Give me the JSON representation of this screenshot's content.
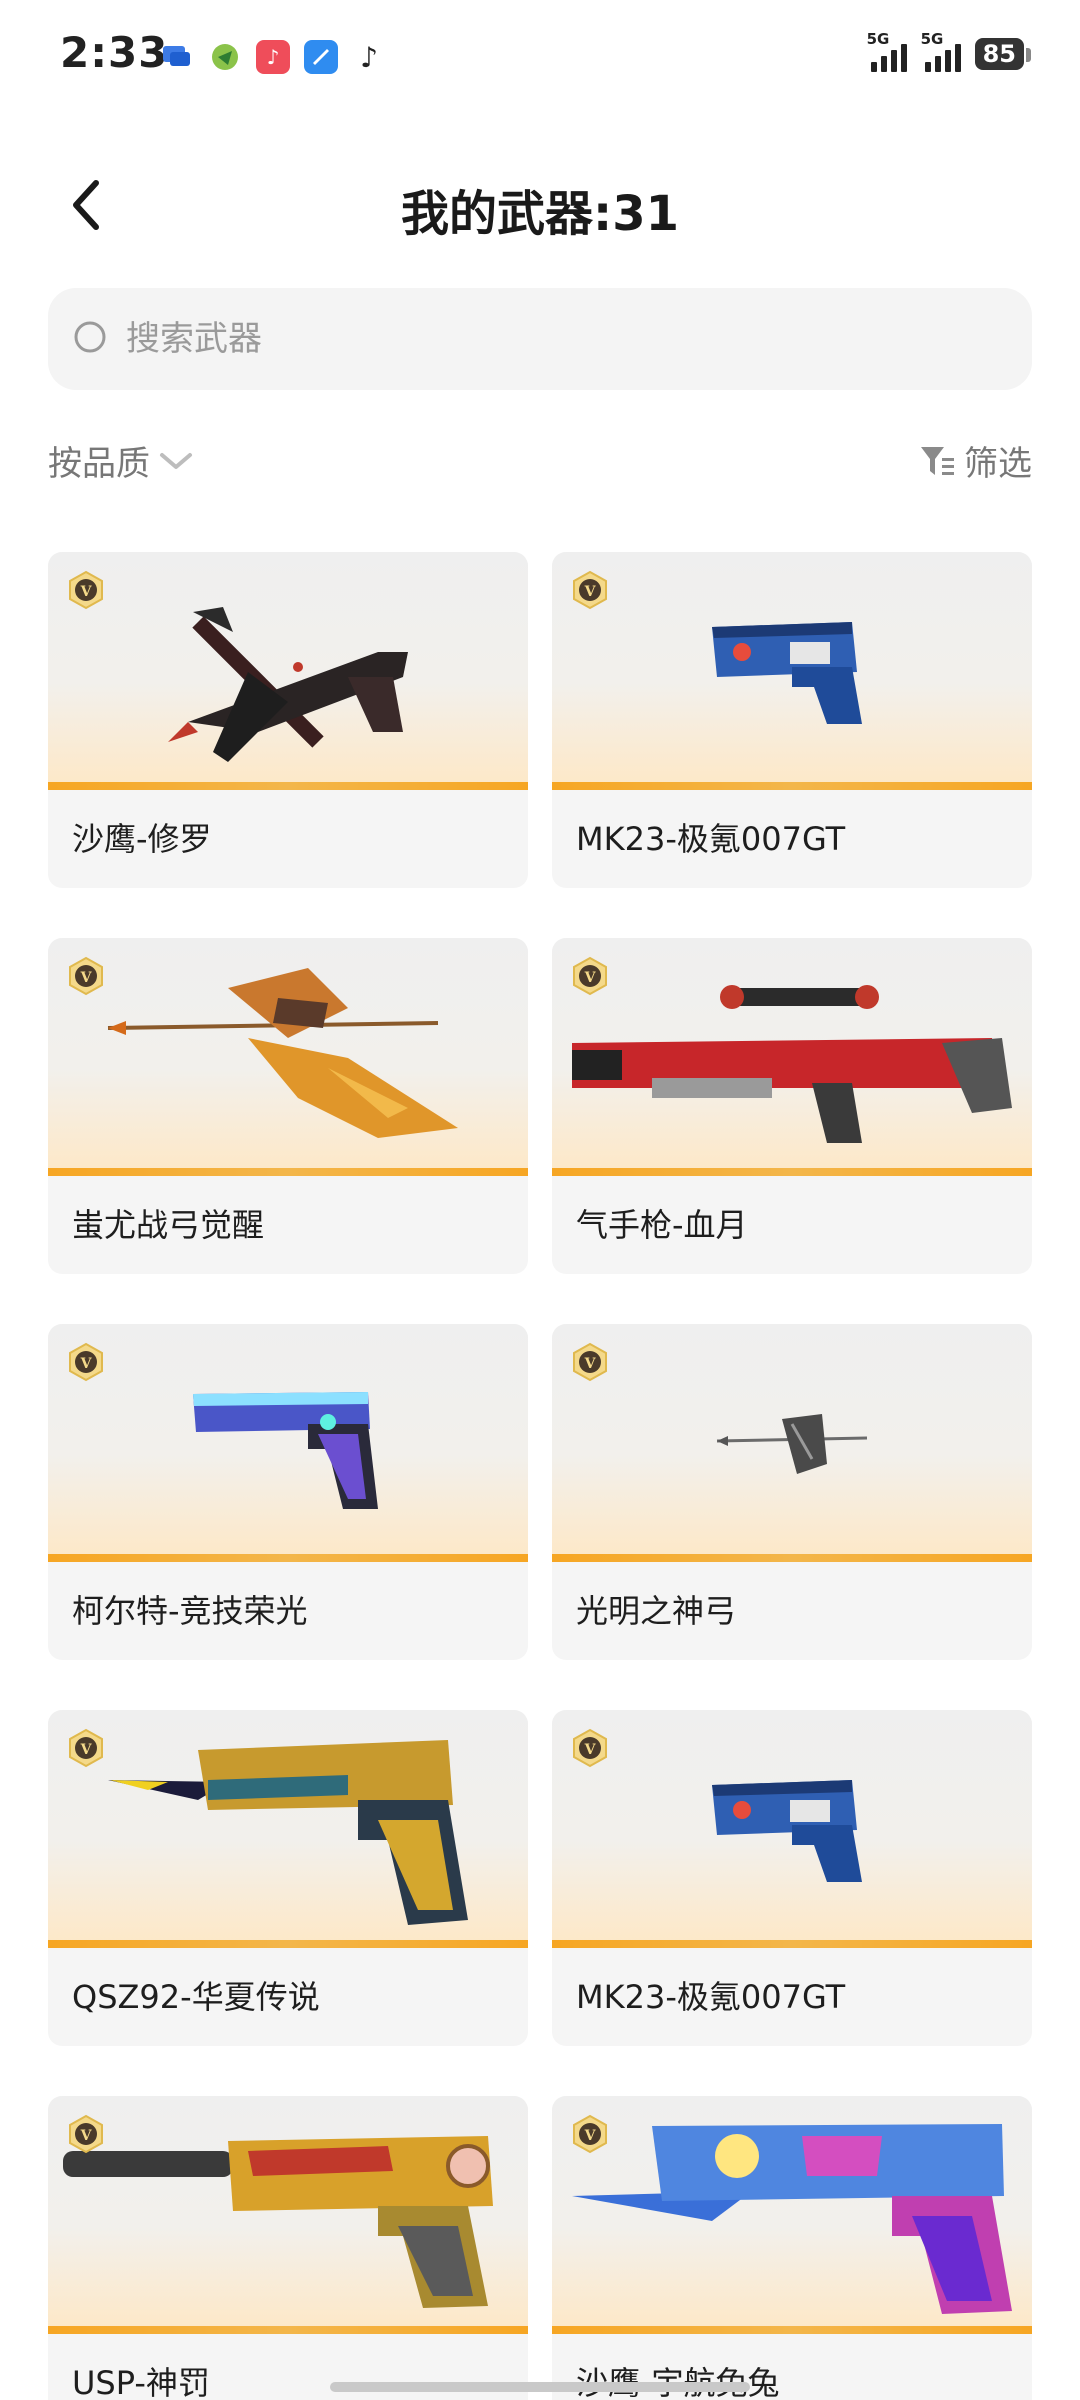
{
  "status_bar": {
    "time": "2:33",
    "signal1_label": "5G",
    "signal2_label": "5G",
    "battery": "85"
  },
  "header": {
    "title": "我的武器:31"
  },
  "search": {
    "placeholder": "搜索武器"
  },
  "filters": {
    "sort_label": "按品质",
    "filter_label": "筛选"
  },
  "weapons": [
    {
      "name": "沙鹰-修罗",
      "icon": "desert-eagle-dark-red"
    },
    {
      "name": "MK23-极氪007GT",
      "icon": "mk23-blue"
    },
    {
      "name": "蚩尤战弓觉醒",
      "icon": "golden-bow"
    },
    {
      "name": "气手枪-血月",
      "icon": "red-rifle"
    },
    {
      "name": "柯尔特-竞技荣光",
      "icon": "colt-purple"
    },
    {
      "name": "光明之神弓",
      "icon": "small-bow"
    },
    {
      "name": "QSZ92-华夏传说",
      "icon": "qsz92-gold-blue"
    },
    {
      "name": "MK23-极氪007GT",
      "icon": "mk23-blue"
    },
    {
      "name": "USP-神罚",
      "icon": "usp-gold"
    },
    {
      "name": "沙鹰-宇航兔兔",
      "icon": "desert-eagle-pink-blue"
    }
  ]
}
